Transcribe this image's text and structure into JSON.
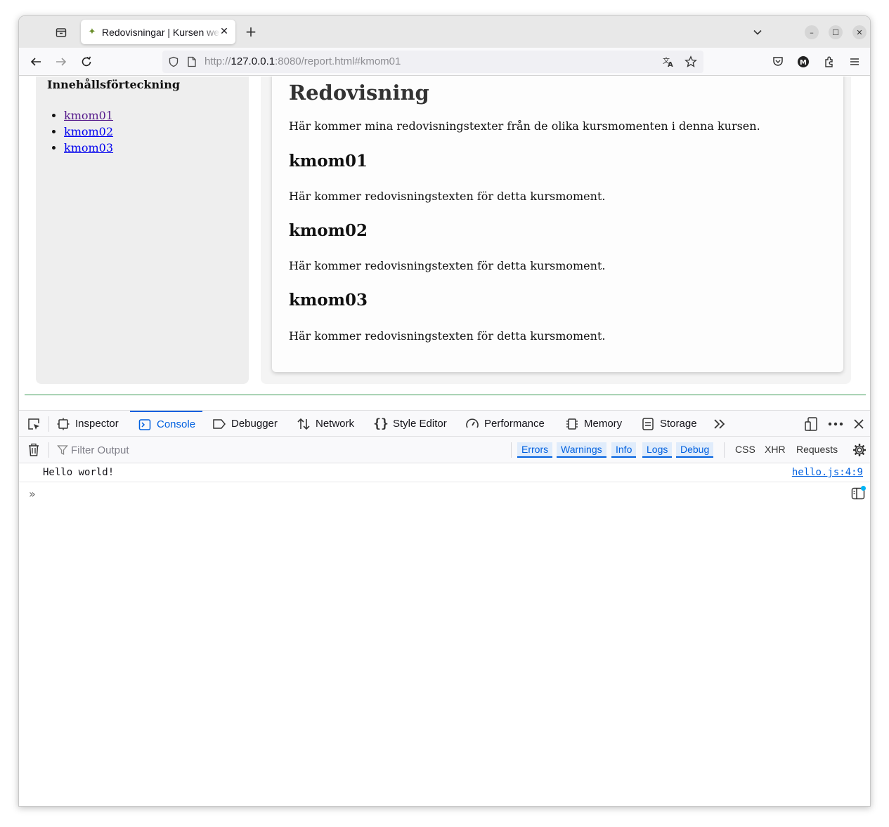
{
  "browser": {
    "tab_title": "Redovisningar | Kursen webapp",
    "url_prefix": "http://",
    "url_host": "127.0.0.1",
    "url_rest": ":8080/report.html#kmom01"
  },
  "sidebar": {
    "title": "Innehållsförteckning",
    "links": [
      {
        "label": "kmom01",
        "state": "visited"
      },
      {
        "label": "kmom02",
        "state": "unvisited"
      },
      {
        "label": "kmom03",
        "state": "unvisited"
      }
    ]
  },
  "main": {
    "heading": "Redovisning",
    "intro": "Här kommer mina redovisningstexter från de olika kursmomenten i denna kursen.",
    "sections": [
      {
        "heading": "kmom01",
        "text": "Här kommer redovisningstexten för detta kursmoment."
      },
      {
        "heading": "kmom02",
        "text": "Här kommer redovisningstexten för detta kursmoment."
      },
      {
        "heading": "kmom03",
        "text": "Här kommer redovisningstexten för detta kursmoment."
      }
    ]
  },
  "devtools": {
    "tabs": [
      "Inspector",
      "Console",
      "Debugger",
      "Network",
      "Style Editor",
      "Performance",
      "Memory",
      "Storage"
    ],
    "selected_tab": "Console",
    "filter_placeholder": "Filter Output",
    "levels": [
      "Errors",
      "Warnings",
      "Info",
      "Logs",
      "Debug"
    ],
    "request_filters": [
      "CSS",
      "XHR",
      "Requests"
    ],
    "messages": [
      {
        "text": "Hello world!",
        "source": "hello.js:4:9"
      }
    ]
  },
  "colors": {
    "accent": "#0060df",
    "visited_link": "#551a8b",
    "link": "#0000ee"
  }
}
